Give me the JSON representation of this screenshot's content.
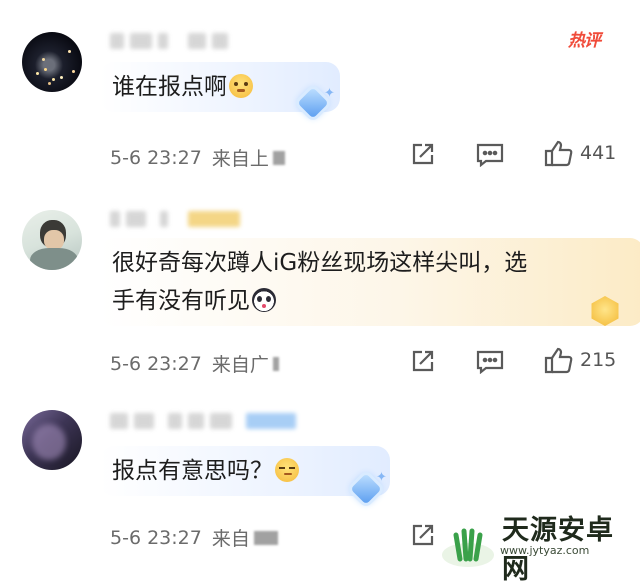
{
  "hot_label": "热评",
  "comments": [
    {
      "text": "谁在报点啊",
      "emoji": "shy-smile-emoji",
      "date": "5-6 23:27",
      "location": "来自上",
      "likes": "441"
    },
    {
      "text_line1": "很好奇每次蹲人iG粉丝现场这样尖叫，选",
      "text_line2": "手有没有听见",
      "emoji": "panda-emoji",
      "date": "5-6 23:27",
      "location": "来自广",
      "likes": "215"
    },
    {
      "text": "报点有意思吗？",
      "emoji": "smirk-emoji",
      "date": "5-6 23:27",
      "location": "来自"
    }
  ],
  "icons": {
    "share": "share-icon",
    "reply": "comment-icon",
    "like": "thumbs-up-icon"
  },
  "watermark": {
    "name": "天源安卓网",
    "url": "www.jytyaz.com"
  },
  "colors": {
    "hot": "#f04b3a",
    "meta_text": "#6b6b6b",
    "watermark_green": "#3aa14a"
  }
}
